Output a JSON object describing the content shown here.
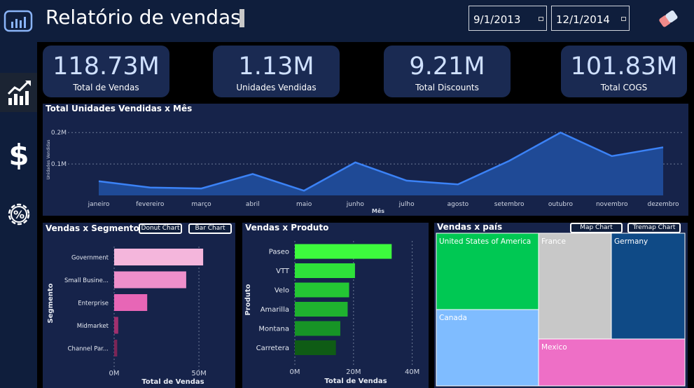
{
  "header": {
    "title": "Relatório de vendas",
    "date_start": "9/1/2013",
    "date_end": "12/1/2014"
  },
  "sidebar": {
    "items": [
      {
        "icon": "chart-icon"
      },
      {
        "icon": "dollar-icon"
      },
      {
        "icon": "percent-gear-icon"
      }
    ]
  },
  "kpis": [
    {
      "value": "118.73M",
      "label": "Total de Vendas"
    },
    {
      "value": "1.13M",
      "label": "Unidades Vendidas"
    },
    {
      "value": "9.21M",
      "label": "Total Discounts"
    },
    {
      "value": "101.83M",
      "label": "Total COGS"
    }
  ],
  "colors": {
    "background": "#0f1e3c",
    "panel": "#16234a",
    "kpi_value": "#cfe0ff",
    "line": "#3b82f6",
    "area": "#1f4a96"
  },
  "line_chart": {
    "title": "Total Unidades Vendidas x Mês",
    "chart_data": {
      "type": "area",
      "x": [
        "janeiro",
        "fevereiro",
        "março",
        "abril",
        "maio",
        "junho",
        "julho",
        "agosto",
        "setembro",
        "outubro",
        "novembro",
        "dezembro"
      ],
      "values": [
        0.045,
        0.025,
        0.022,
        0.068,
        0.015,
        0.105,
        0.047,
        0.035,
        0.11,
        0.2,
        0.125,
        0.153
      ],
      "xlabel": "Mês",
      "ylabel": "Unidades Vendidas",
      "ytick_labels": [
        "0.1M",
        "0.2M"
      ],
      "ytick_values": [
        0.1,
        0.2
      ],
      "ylim": [
        0,
        0.225
      ],
      "grid": true
    }
  },
  "segment_chart": {
    "title": "Vendas x Segmento",
    "buttons": [
      "Donut Chart",
      "Bar Chart"
    ],
    "chart_data": {
      "type": "bar",
      "orientation": "horizontal",
      "categories": [
        "Government",
        "Small Busine...",
        "Enterprise",
        "Midmarket",
        "Channel Par..."
      ],
      "values": [
        52.5,
        42.5,
        19.5,
        2.4,
        1.8
      ],
      "colors": [
        "#f4b6dc",
        "#ee8fcb",
        "#e766b6",
        "#a0306e",
        "#7b2556"
      ],
      "xlabel": "Total de Vendas",
      "ylabel": "Segmento",
      "xtick_labels": [
        "0M",
        "50M"
      ],
      "xtick_values": [
        0,
        50
      ],
      "xlim": [
        0,
        57
      ]
    }
  },
  "product_chart": {
    "title": "Vendas x Produto",
    "chart_data": {
      "type": "bar",
      "orientation": "horizontal",
      "categories": [
        "Paseo",
        "VTT",
        "Velo",
        "Amarilla",
        "Montana",
        "Carretera"
      ],
      "values": [
        33,
        20.5,
        18.5,
        18,
        15.5,
        14
      ],
      "colors": [
        "#3dfb3d",
        "#2ee23a",
        "#24c734",
        "#1fb22f",
        "#179426",
        "#0f5c15"
      ],
      "xlabel": "Total de Vendas",
      "ylabel": "Produto",
      "xtick_labels": [
        "0M",
        "20M",
        "40M"
      ],
      "xtick_values": [
        0,
        20,
        40
      ],
      "xlim": [
        0,
        42
      ]
    }
  },
  "country_chart": {
    "title": "Vendas x país",
    "buttons": [
      "Map Chart",
      "Tremap Chart"
    ],
    "chart_data": {
      "type": "treemap",
      "items": [
        {
          "name": "United States of America",
          "color": "#00c853"
        },
        {
          "name": "Canada",
          "color": "#7fbcff"
        },
        {
          "name": "France",
          "color": "#c8c8c8"
        },
        {
          "name": "Germany",
          "color": "#0f4a86"
        },
        {
          "name": "Mexico",
          "color": "#ee6fc6"
        }
      ]
    }
  }
}
